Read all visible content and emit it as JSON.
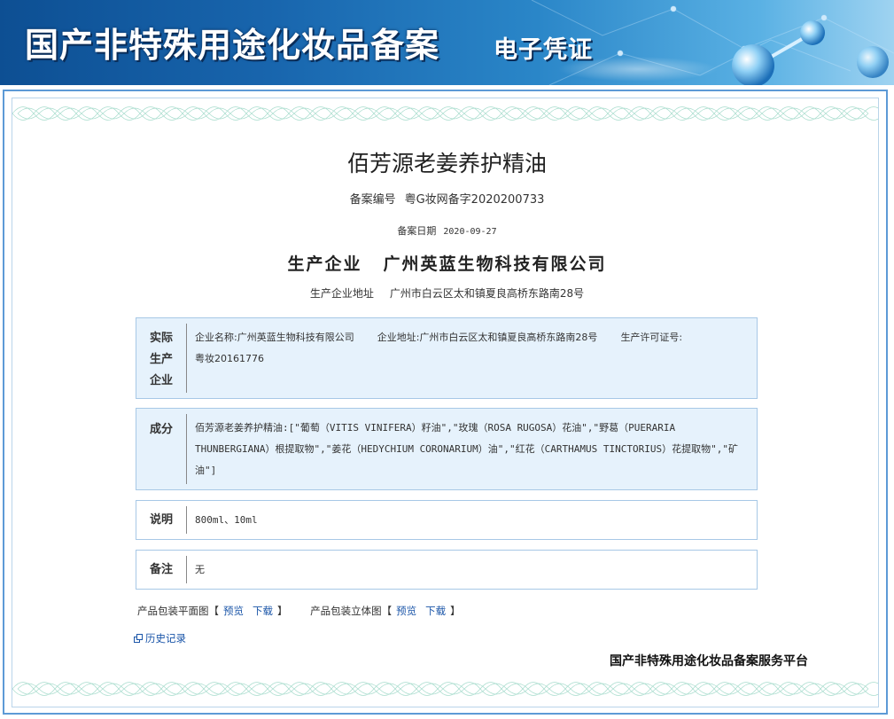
{
  "header": {
    "title": "国产非特殊用途化妆品备案",
    "subtitle": "电子凭证"
  },
  "product": {
    "name": "佰芳源老姜养护精油",
    "reg_no_label": "备案编号",
    "reg_no": "粤G妆网备字2020200733",
    "reg_date_label": "备案日期",
    "reg_date": "2020-09-27",
    "producer_label": "生产企业",
    "producer": "广州英蓝生物科技有限公司",
    "producer_addr_label": "生产企业地址",
    "producer_addr": "广州市白云区太和镇夏良高桥东路南28号"
  },
  "actual_producer": {
    "label_lines": [
      "实际",
      "生产",
      "企业"
    ],
    "name_label": "企业名称:",
    "name": "广州英蓝生物科技有限公司",
    "addr_label": "企业地址:",
    "addr": "广州市白云区太和镇夏良高桥东路南28号",
    "license_label": "生产许可证号:",
    "license": "粤妆20161776"
  },
  "ingredients": {
    "label": "成分",
    "line1": "佰芳源老姜养护精油:[\"葡萄（VITIS VINIFERA）籽油\",\"玫瑰（ROSA RUGOSA）花油\",\"野葛（PUERARIA",
    "line2": "THUNBERGIANA）根提取物\",\"姜花（HEDYCHIUM CORONARIUM）油\",\"红花（CARTHAMUS TINCTORIUS）花提取物\",\"矿油\"]"
  },
  "description": {
    "label": "说明",
    "value": "800ml、10ml"
  },
  "remark": {
    "label": "备注",
    "value": "无"
  },
  "downloads": {
    "flat_label": "产品包装平面图",
    "flat_preview": "预览",
    "flat_download": "下载",
    "solid_label": "产品包装立体图",
    "solid_preview": "预览",
    "solid_download": "下载",
    "bracket_open": "【",
    "bracket_close": "】"
  },
  "history_link": "历史记录",
  "footer_platform": "国产非特殊用途化妆品备案服务平台",
  "colors": {
    "banner": "#1865ad",
    "frame_border": "#5d9ad6",
    "box_bg": "#e6f2fc",
    "box_border": "#a7c8e6",
    "link": "#1a55a8"
  },
  "icons": [
    "molecule-decoration-icon",
    "history-icon"
  ]
}
